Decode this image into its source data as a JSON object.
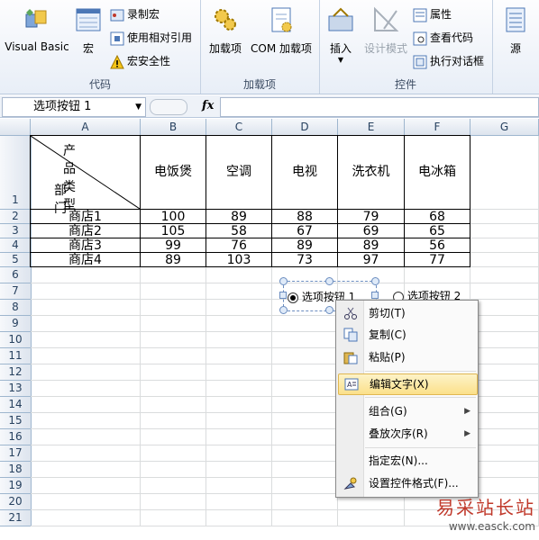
{
  "ribbon": {
    "code_group": {
      "title": "代码",
      "visual_basic": "Visual Basic",
      "macros": "宏",
      "record_macro": "录制宏",
      "relative_ref": "使用相对引用",
      "macro_security": "宏安全性"
    },
    "addins_group": {
      "title": "加载项",
      "addins": "加载项",
      "com_addins": "COM 加载项"
    },
    "controls_group": {
      "title": "控件",
      "insert": "插入",
      "design_mode": "设计模式",
      "properties": "属性",
      "view_code": "查看代码",
      "run_dialog": "执行对话框"
    },
    "source": "源"
  },
  "formula_bar": {
    "name_box": "选项按钮 1",
    "fx": "fx",
    "content": ""
  },
  "columns": [
    "A",
    "B",
    "C",
    "D",
    "E",
    "F",
    "G"
  ],
  "rows": [
    "1",
    "2",
    "3",
    "4",
    "5",
    "6",
    "7",
    "8",
    "9",
    "10",
    "11",
    "12",
    "13",
    "14",
    "15",
    "16",
    "17",
    "18",
    "19",
    "20",
    "21"
  ],
  "table": {
    "header_top": "产品类型",
    "header_bottom": "部门",
    "products": [
      "电饭煲",
      "空调",
      "电视",
      "洗衣机",
      "电冰箱"
    ],
    "stores": [
      {
        "name": "商店1",
        "values": [
          100,
          89,
          88,
          79,
          68
        ]
      },
      {
        "name": "商店2",
        "values": [
          105,
          58,
          67,
          69,
          65
        ]
      },
      {
        "name": "商店3",
        "values": [
          99,
          76,
          89,
          89,
          56
        ]
      },
      {
        "name": "商店4",
        "values": [
          89,
          103,
          73,
          97,
          77
        ]
      }
    ]
  },
  "controls": {
    "option1": "选项按钮 1",
    "option2": "选项按钮 2"
  },
  "context_menu": {
    "cut": "剪切(T)",
    "copy": "复制(C)",
    "paste": "粘贴(P)",
    "edit_text": "编辑文字(X)",
    "group": "组合(G)",
    "order": "叠放次序(R)",
    "assign_macro": "指定宏(N)...",
    "format_control": "设置控件格式(F)..."
  },
  "watermark": {
    "cn": "易采站长站",
    "url": "www.easck.com"
  }
}
